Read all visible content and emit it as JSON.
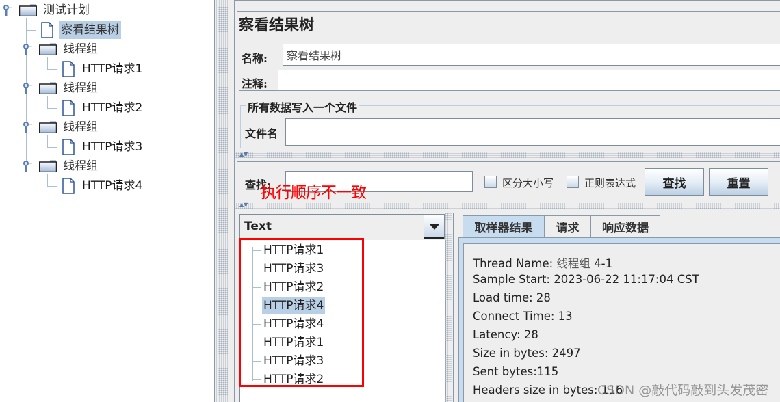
{
  "test_tree": {
    "root": "测试计划",
    "items": [
      {
        "label": "察看结果树",
        "type": "listener",
        "selected": true
      },
      {
        "label": "线程组",
        "type": "thread-group",
        "children": [
          "HTTP请求1"
        ]
      },
      {
        "label": "线程组",
        "type": "thread-group",
        "children": [
          "HTTP请求2"
        ]
      },
      {
        "label": "线程组",
        "type": "thread-group",
        "children": [
          "HTTP请求3"
        ]
      },
      {
        "label": "线程组",
        "type": "thread-group",
        "children": [
          "HTTP请求4"
        ]
      }
    ]
  },
  "panel": {
    "title": "察看结果树",
    "name_label": "名称:",
    "name_value": "察看结果树",
    "comment_label": "注释:",
    "comment_value": "",
    "file_group_title": "所有数据写入一个文件",
    "filename_label": "文件名",
    "filename_value": ""
  },
  "search": {
    "label": "查找:",
    "value": "",
    "case_sensitive_label": "区分大小写",
    "case_sensitive_checked": false,
    "regex_label": "正则表达式",
    "regex_checked": false,
    "find_button": "查找",
    "reset_button": "重置"
  },
  "annotation": "执行顺序不一致",
  "results": {
    "renderer": "Text",
    "items": [
      {
        "label": "HTTP请求1",
        "selected": false
      },
      {
        "label": "HTTP请求3",
        "selected": false
      },
      {
        "label": "HTTP请求2",
        "selected": false
      },
      {
        "label": "HTTP请求4",
        "selected": true
      },
      {
        "label": "HTTP请求4",
        "selected": false
      },
      {
        "label": "HTTP请求1",
        "selected": false
      },
      {
        "label": "HTTP请求3",
        "selected": false
      },
      {
        "label": "HTTP请求2",
        "selected": false
      }
    ]
  },
  "detail_tabs": {
    "tabs": [
      "取样器结果",
      "请求",
      "响应数据"
    ],
    "active": 0
  },
  "sampler_result": {
    "thread_name_key": "Thread Name: ",
    "thread_name_cn": "线程组",
    "thread_name_suffix": " 4-1",
    "lines": [
      "Sample Start: 2023-06-22 11:17:04 CST",
      "Load time: 28",
      "Connect Time: 13",
      "Latency: 28",
      "Size in bytes: 2497",
      "Sent bytes:115",
      "Headers size in bytes: 116"
    ]
  },
  "watermark": "CSDN @敲代码敲到头发茂密",
  "colors": {
    "selection": "#b8cfe5",
    "annotation_red": "#ff0000",
    "border": "#8a99a8"
  }
}
